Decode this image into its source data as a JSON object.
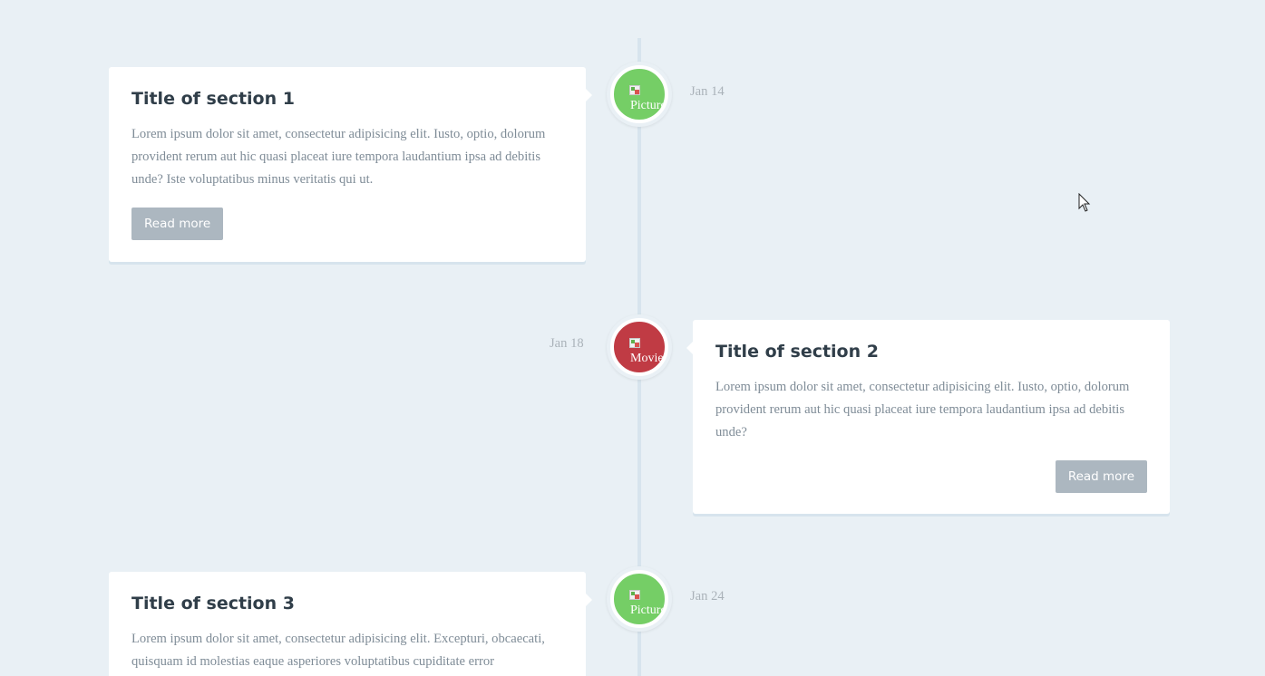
{
  "timeline": {
    "items": [
      {
        "title": "Title of section 1",
        "body": "Lorem ipsum dolor sit amet, consectetur adipisicing elit. Iusto, optio, dolorum provident rerum aut hic quasi placeat iure tempora laudantium ipsa ad debitis unde? Iste voluptatibus minus veritatis qui ut.",
        "button_label": "Read more",
        "date": "Jan 14",
        "icon_alt": "Picture",
        "icon": "picture-icon",
        "color": "#75ce66"
      },
      {
        "title": "Title of section 2",
        "body": "Lorem ipsum dolor sit amet, consectetur adipisicing elit. Iusto, optio, dolorum provident rerum aut hic quasi placeat iure tempora laudantium ipsa ad debitis unde?",
        "button_label": "Read more",
        "date": "Jan 18",
        "icon_alt": "Movie",
        "icon": "movie-icon",
        "color": "#c03b44"
      },
      {
        "title": "Title of section 3",
        "body": "Lorem ipsum dolor sit amet, consectetur adipisicing elit. Excepturi, obcaecati, quisquam id molestias eaque asperiores voluptatibus cupiditate error",
        "date": "Jan 24",
        "icon_alt": "Picture",
        "icon": "picture-icon",
        "color": "#75ce66"
      }
    ]
  },
  "colors": {
    "background": "#e9f0f5",
    "card": "#ffffff",
    "title": "#303e49",
    "body_text": "#7f8c97",
    "button": "#acb7c0",
    "date": "#aab2b9",
    "line": "#d7e4ed"
  }
}
